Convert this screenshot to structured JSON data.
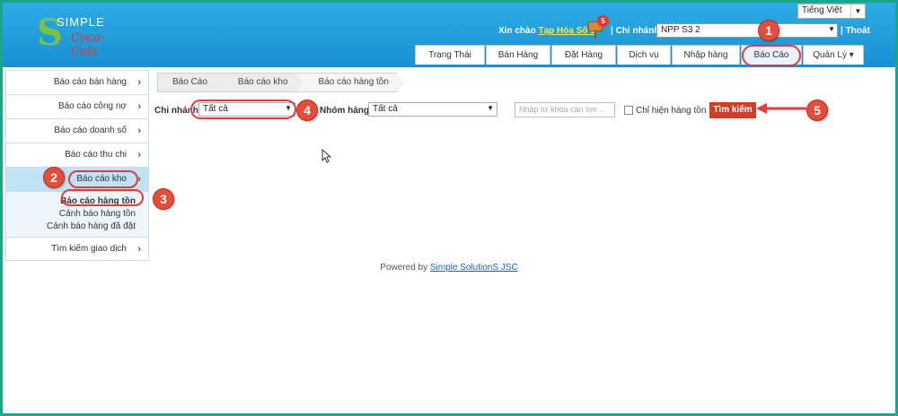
{
  "header": {
    "logo_text": "SIMPLE",
    "logo_brand": "Coca-Cola",
    "language": "Tiếng Việt",
    "greeting_prefix": "Xin chào",
    "user": "Tạp Hóa Số 9",
    "notification_count": "5",
    "branch_label": "Chi nhánh:",
    "branch_value": "NPP S3 2",
    "logout": "Thoát"
  },
  "nav": {
    "tabs": [
      {
        "label": "Trạng Thái"
      },
      {
        "label": "Bán Hàng"
      },
      {
        "label": "Đặt Hàng"
      },
      {
        "label": "Dịch vụ"
      },
      {
        "label": "Nhập hàng"
      },
      {
        "label": "Báo Cáo"
      },
      {
        "label": "Quản Lý"
      }
    ]
  },
  "sidebar": {
    "items": [
      {
        "label": "Báo cáo bán hàng"
      },
      {
        "label": "Báo cáo công nợ"
      },
      {
        "label": "Báo cáo doanh số"
      },
      {
        "label": "Báo cáo thu chi"
      },
      {
        "label": "Báo cáo kho"
      },
      {
        "label": "Tìm kiếm giao dịch"
      }
    ],
    "sub_items": [
      {
        "label": "Báo cáo hàng tồn"
      },
      {
        "label": "Cảnh báo hàng tồn"
      },
      {
        "label": "Cảnh báo hàng đã đặt"
      }
    ]
  },
  "breadcrumb": [
    "Báo Cáo",
    "Báo cáo kho",
    "Báo cáo hàng tồn"
  ],
  "filters": {
    "branch_label": "Chi nhánh:",
    "branch_value": "Tất cả",
    "group_label": "Nhóm hàng:",
    "group_value": "Tất cả",
    "search_placeholder": "Nhập từ khóa cần tìm ...",
    "stock_only_label": "Chỉ hiện hàng tồn",
    "search_button": "Tìm kiếm"
  },
  "footer": {
    "prefix": "Powered by",
    "company": "Simple SolutionS JSC"
  },
  "annotations": [
    "1",
    "2",
    "3",
    "4",
    "5"
  ],
  "colors": {
    "header": "#1a8fd0",
    "frame": "#1aa68a",
    "button": "#d63b25",
    "marker": "#e54d3a"
  }
}
